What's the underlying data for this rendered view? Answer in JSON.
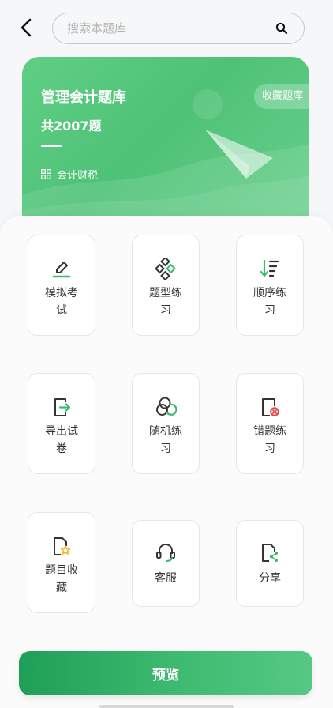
{
  "search": {
    "placeholder": "搜索本题库"
  },
  "banner": {
    "title": "管理会计题库",
    "count": "共2007题",
    "category": "会计财税",
    "favorite_label": "收藏题库",
    "accent": "#4fc277"
  },
  "tiles": [
    {
      "label": "模拟考试",
      "icon": "pencil-icon"
    },
    {
      "label": "题型练习",
      "icon": "diamonds-icon"
    },
    {
      "label": "顺序练习",
      "icon": "sort-list-icon"
    },
    {
      "label": "导出试卷",
      "icon": "export-doc-icon"
    },
    {
      "label": "随机练习",
      "icon": "random-circles-icon"
    },
    {
      "label": "错题练习",
      "icon": "wrong-doc-icon"
    },
    {
      "label": "题目收藏",
      "icon": "star-doc-icon"
    },
    {
      "label": "客服",
      "icon": "headset-icon"
    },
    {
      "label": "分享",
      "icon": "share-doc-icon"
    }
  ],
  "preview_label": "预览"
}
